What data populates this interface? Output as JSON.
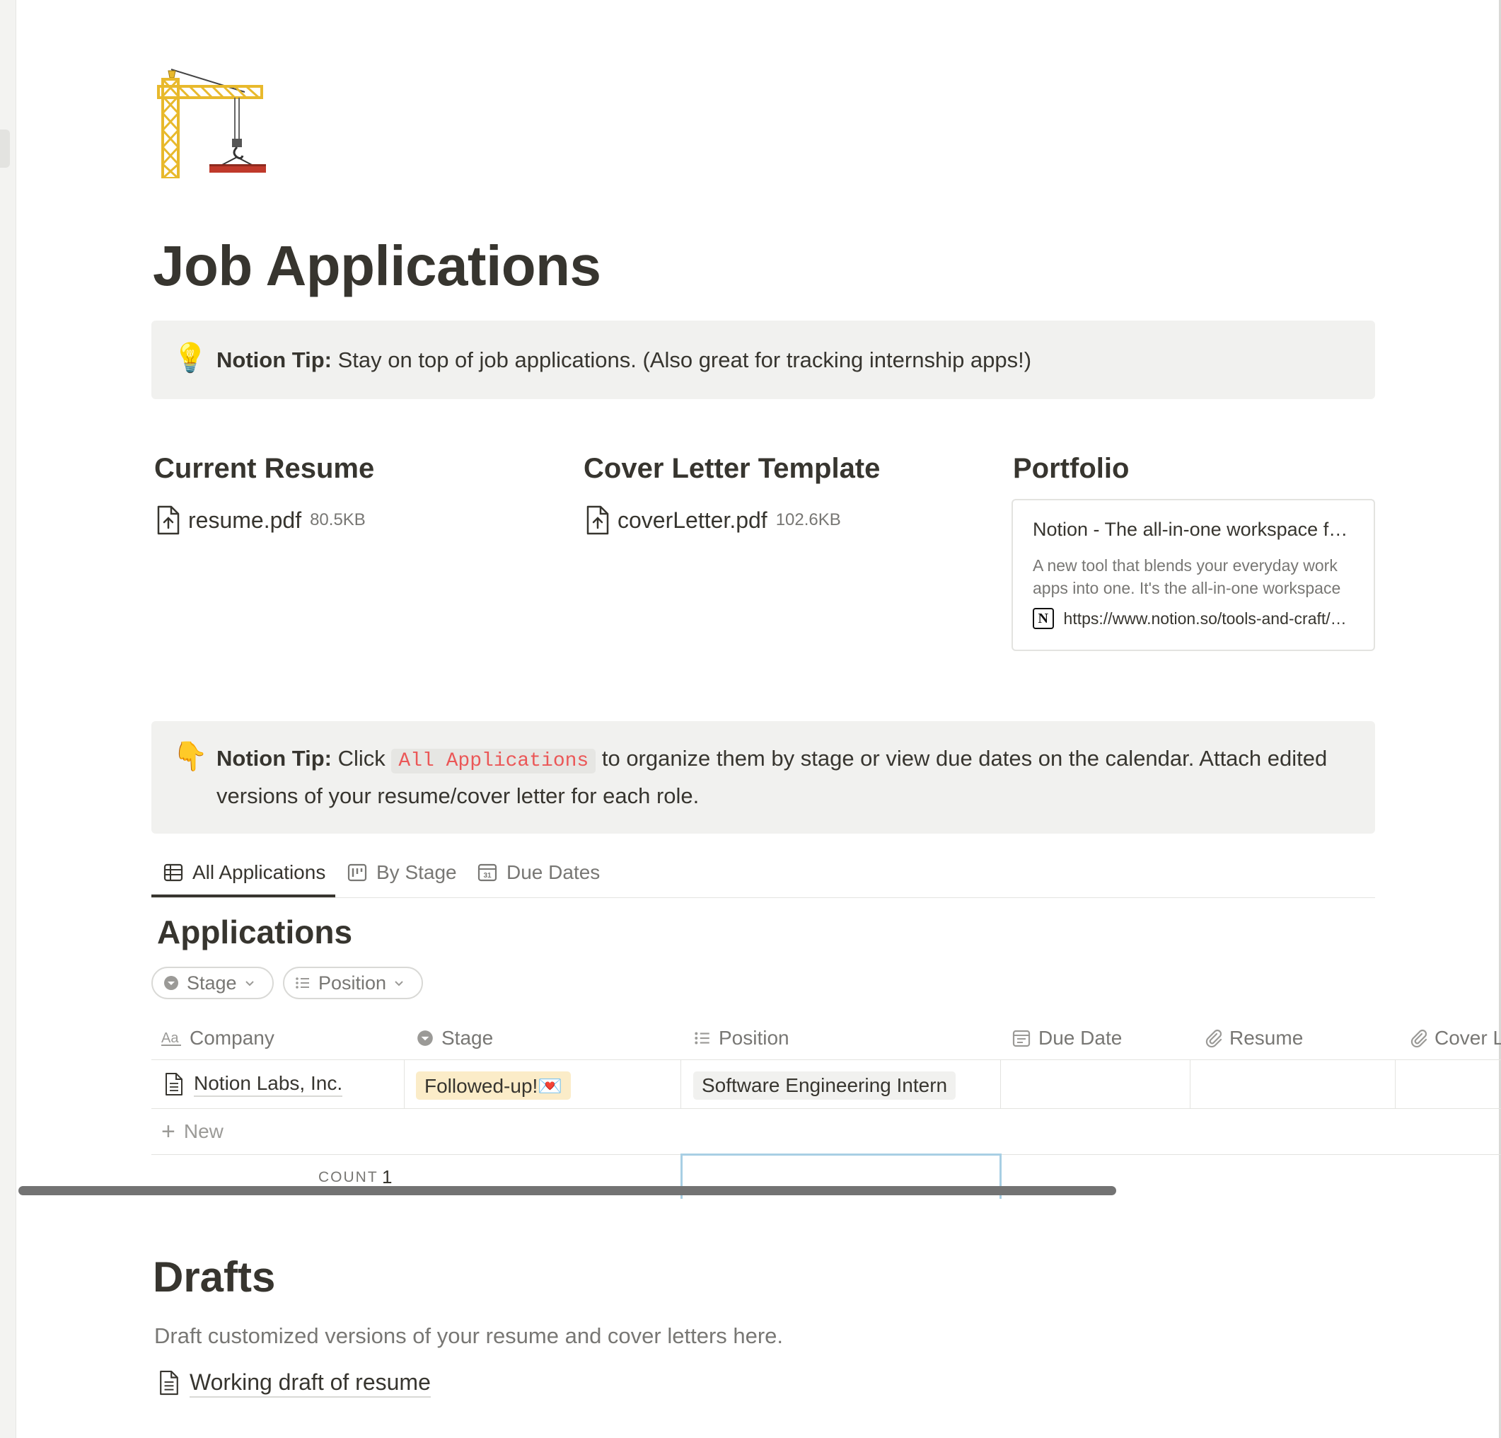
{
  "page": {
    "icon": "construction-crane-icon",
    "title": "Job Applications"
  },
  "callout_top": {
    "icon": "💡",
    "label": "Notion Tip:",
    "text": " Stay on top of job applications. (Also great for tracking internship apps!)"
  },
  "columns": [
    {
      "heading": "Current Resume",
      "file_name": "resume.pdf",
      "file_size": "80.5KB"
    },
    {
      "heading": "Cover Letter Template",
      "file_name": "coverLetter.pdf",
      "file_size": "102.6KB"
    },
    {
      "heading": "Portfolio"
    }
  ],
  "bookmark": {
    "title": "Notion - The all-in-one workspace for your notes, tasks, wikis, and databases.",
    "description": "A new tool that blends your everyday work apps into one. It's the all-in-one workspace for you and your team",
    "url": "https://www.notion.so/tools-and-craft/notion"
  },
  "callout_bottom": {
    "icon": "👇",
    "label": "Notion Tip:",
    "pre": " Click ",
    "code": "All Applications",
    "post": " to organize them by stage or view due dates on the calendar. Attach edited versions of your resume/cover letter for each role."
  },
  "tabs": [
    {
      "label": "All Applications",
      "icon": "table-icon",
      "active": true
    },
    {
      "label": "By Stage",
      "icon": "board-icon"
    },
    {
      "label": "Due Dates",
      "icon": "calendar-icon"
    }
  ],
  "database": {
    "title": "Applications",
    "filters": [
      {
        "label": "Stage",
        "icon": "select-icon"
      },
      {
        "label": "Position",
        "icon": "list-icon"
      }
    ],
    "columns": [
      "Company",
      "Stage",
      "Position",
      "Due Date",
      "Resume",
      "Cover Letter"
    ],
    "rows": [
      {
        "company": "Notion Labs, Inc.",
        "stage": "Followed-up!💌",
        "position": "Software Engineering Intern",
        "due_date": "",
        "resume": "",
        "cover_letter": ""
      }
    ],
    "new_label": "New",
    "count_label": "COUNT",
    "count_value": "1"
  },
  "drafts": {
    "title": "Drafts",
    "description": "Draft customized versions of your resume and cover letters here.",
    "link": "Working draft of resume"
  },
  "colors": {
    "text": "#37352f",
    "muted": "#787774",
    "callout_bg": "#f1f1ef",
    "stage_pill_bg": "#fbecc8",
    "code_red": "#eb5757"
  }
}
